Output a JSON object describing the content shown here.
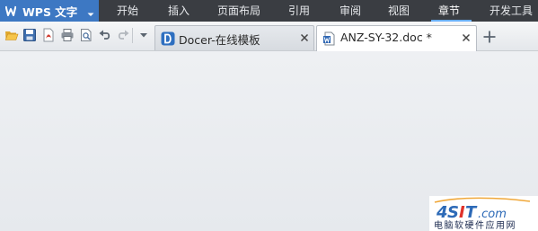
{
  "app": {
    "title": "WPS 文字"
  },
  "menu": {
    "items": [
      {
        "label": "开始"
      },
      {
        "label": "插入"
      },
      {
        "label": "页面布局"
      },
      {
        "label": "引用"
      },
      {
        "label": "审阅"
      },
      {
        "label": "视图"
      },
      {
        "label": "章节"
      },
      {
        "label": "开发工具"
      }
    ],
    "active_index": 6
  },
  "tabs": [
    {
      "label": "Docer-在线模板",
      "icon": "docer-icon",
      "active": false
    },
    {
      "label": "ANZ-SY-32.doc *",
      "icon": "word-doc-icon",
      "active": true
    }
  ],
  "watermark": {
    "brand": "4SIT.com",
    "caption": "电脑软硬件应用网"
  },
  "colors": {
    "menubar": "#3a3d42",
    "app_button": "#3d78c3",
    "active_underline": "#6ab0ff"
  }
}
